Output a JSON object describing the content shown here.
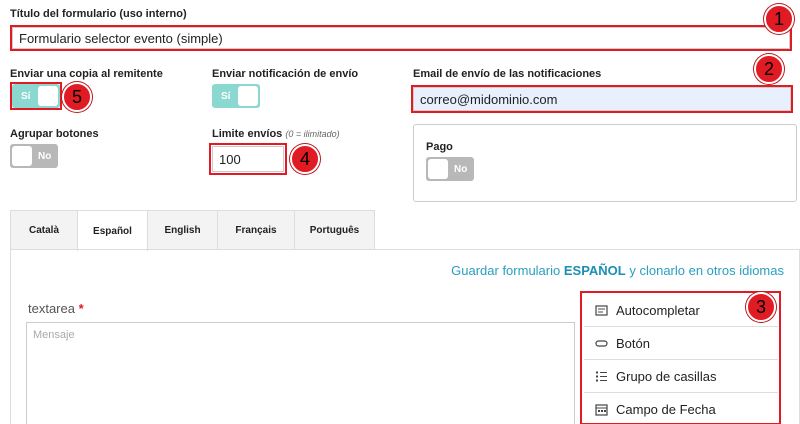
{
  "form_title": {
    "label": "Título del formulario (uso interno)",
    "value": "Formulario selector evento (simple)"
  },
  "send_copy": {
    "label": "Enviar una copia al remitente",
    "toggle_text": "Sí",
    "state": "on"
  },
  "send_notification": {
    "label": "Enviar notificación de envío",
    "toggle_text": "Sí",
    "state": "on"
  },
  "notification_email": {
    "label": "Email de envío de las notificaciones",
    "value": "correo@midominio.com"
  },
  "group_buttons": {
    "label": "Agrupar botones",
    "toggle_text": "No",
    "state": "off"
  },
  "send_limit": {
    "label": "Limite envíos",
    "hint": "(0 = ilimitado)",
    "value": "100"
  },
  "payment": {
    "label": "Pago",
    "toggle_text": "No",
    "state": "off"
  },
  "tabs": [
    {
      "label": "Català",
      "active": false
    },
    {
      "label": "Español",
      "active": true
    },
    {
      "label": "English",
      "active": false
    },
    {
      "label": "Français",
      "active": false
    },
    {
      "label": "Português",
      "active": false
    }
  ],
  "save_link": {
    "prefix": "Guardar formulario ",
    "lang": "ESPAÑOL",
    "suffix": " y clonarlo en otros idiomas"
  },
  "textarea_field": {
    "label": "textarea",
    "required_mark": "*",
    "placeholder": "Mensaje"
  },
  "palette": [
    {
      "label": "Autocompletar",
      "icon": "autocomplete-icon"
    },
    {
      "label": "Botón",
      "icon": "button-icon"
    },
    {
      "label": "Grupo de casillas",
      "icon": "checkbox-group-icon"
    },
    {
      "label": "Campo de Fecha",
      "icon": "calendar-icon"
    }
  ],
  "annotations": [
    "1",
    "2",
    "3",
    "4",
    "5"
  ],
  "colors": {
    "annotation_red": "#e01b24",
    "toggle_on": "#8ad8d0",
    "toggle_off": "#b8b8b8",
    "link": "#2a9fc0"
  }
}
